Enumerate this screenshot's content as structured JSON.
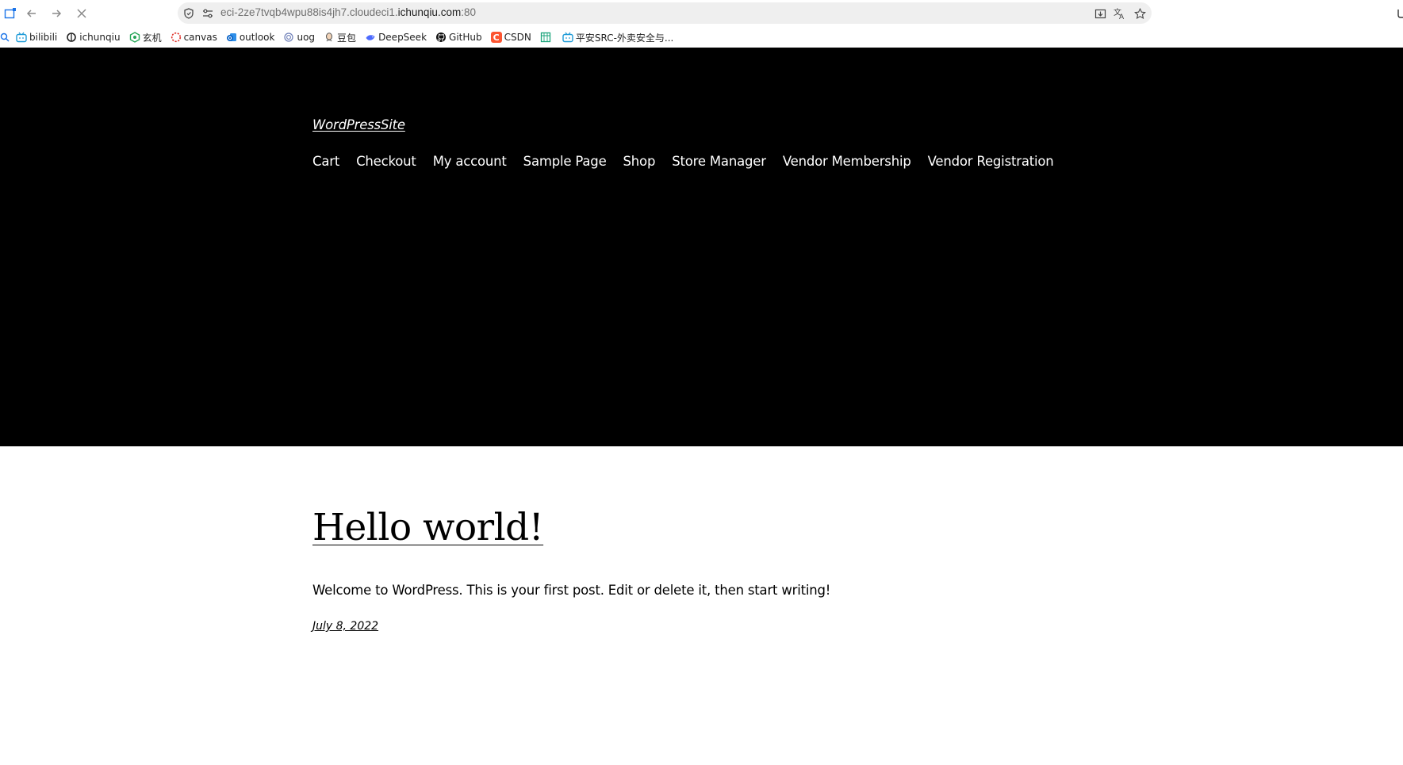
{
  "browser": {
    "url_prefix": "eci-2ze7tvqb4wpu88is4jh7.cloudeci1.",
    "url_host": "ichunqiu.com",
    "url_suffix": ":80",
    "icons": {
      "tab_menu": "tab-menu-icon",
      "back": "back-arrow-icon",
      "forward": "forward-arrow-icon",
      "stop": "close-icon",
      "security": "shield-icon",
      "site_settings": "tune-icon",
      "install": "install-app-icon",
      "translate": "translate-icon",
      "bookmark": "star-icon"
    }
  },
  "bookmarks": [
    {
      "label": "bilibili",
      "icon": "bilibili-icon",
      "color": "#1e9bd7"
    },
    {
      "label": "ichunqiu",
      "icon": "ichunqiu-icon",
      "color": "#222222"
    },
    {
      "label": "玄机",
      "icon": "xuanji-icon",
      "color": "#23a455"
    },
    {
      "label": "canvas",
      "icon": "canvas-icon",
      "color": "#e0322a"
    },
    {
      "label": "outlook",
      "icon": "outlook-icon",
      "color": "#0a64c8"
    },
    {
      "label": "uog",
      "icon": "uog-icon",
      "color": "#6e7fb8"
    },
    {
      "label": "豆包",
      "icon": "doubao-icon",
      "color": "#555555"
    },
    {
      "label": "DeepSeek",
      "icon": "deepseek-icon",
      "color": "#4d6bfe"
    },
    {
      "label": "GitHub",
      "icon": "github-icon",
      "color": "#111111"
    },
    {
      "label": "CSDN",
      "icon": "csdn-icon",
      "color": "#fc5531"
    },
    {
      "label": "",
      "icon": "doc-icon",
      "color": "#1aa37a"
    },
    {
      "label": "平安SRC-外卖安全与...",
      "icon": "pingan-icon",
      "color": "#1e9bd7"
    }
  ],
  "site": {
    "title": "WordPressSite",
    "nav": [
      "Cart",
      "Checkout",
      "My account",
      "Sample Page",
      "Shop",
      "Store Manager",
      "Vendor Membership",
      "Vendor Registration"
    ]
  },
  "post": {
    "title": "Hello world!",
    "excerpt": "Welcome to WordPress. This is your first post. Edit or delete it, then start writing!",
    "date": "July 8, 2022"
  },
  "colors": {
    "header_bg": "#000000",
    "page_bg": "#ffffff",
    "address_bg": "#efefef"
  }
}
